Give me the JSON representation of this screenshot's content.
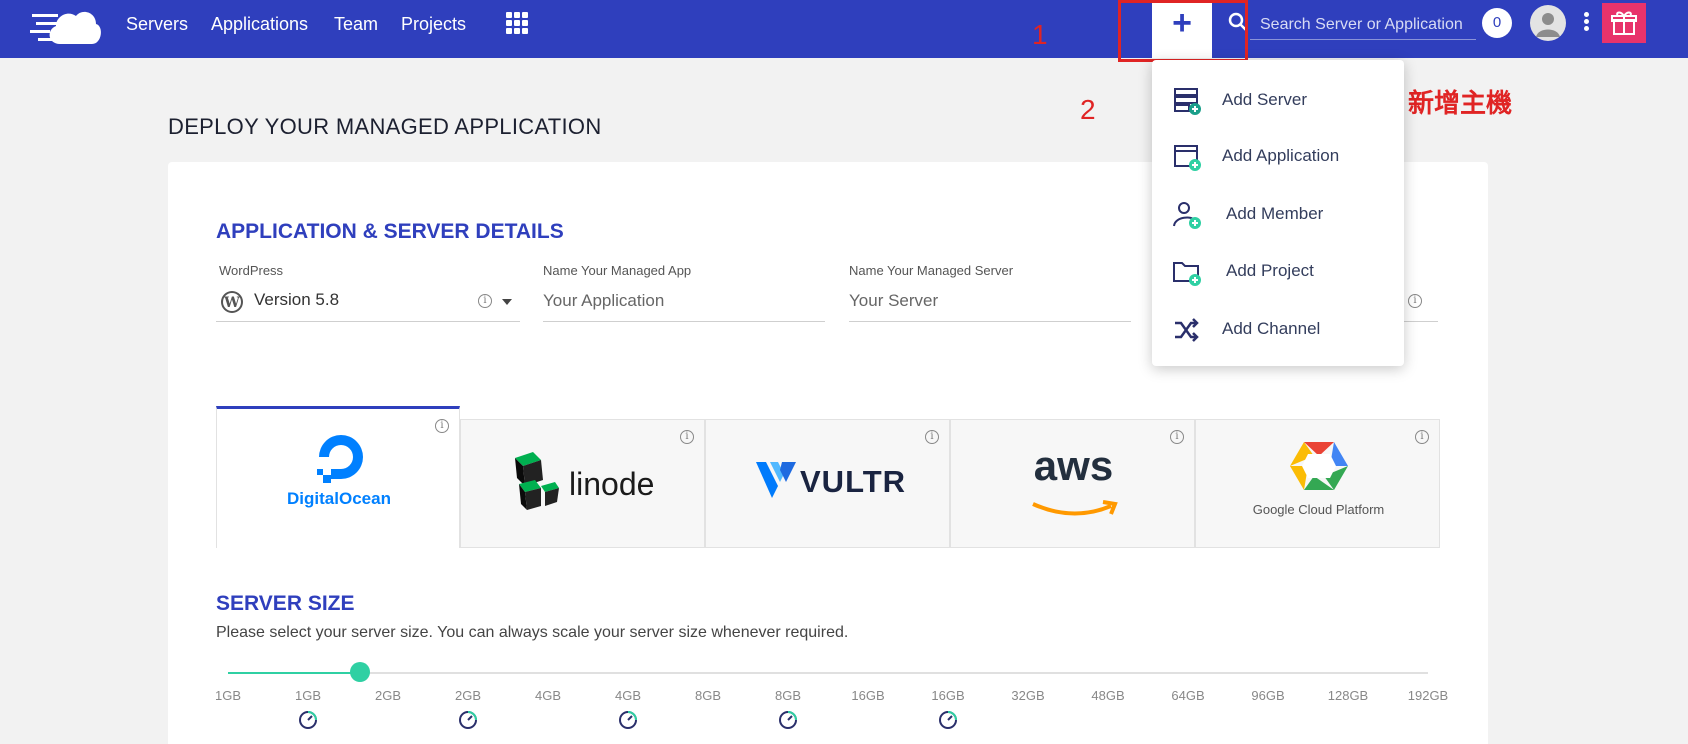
{
  "nav": {
    "items": [
      "Servers",
      "Applications",
      "Team",
      "Projects"
    ],
    "search_placeholder": "Search Server or Application",
    "notifications": "0",
    "plus": "+"
  },
  "annotations": {
    "step1": "1",
    "step2": "2",
    "add_server_cn": "新增主機"
  },
  "menu": {
    "items": [
      "Add Server",
      "Add Application",
      "Add Member",
      "Add Project",
      "Add Channel"
    ]
  },
  "page": {
    "title": "DEPLOY YOUR MANAGED APPLICATION"
  },
  "details": {
    "title": "APPLICATION & SERVER DETAILS",
    "app_label": "WordPress",
    "app_version": "Version 5.8",
    "name_app_label": "Name Your Managed App",
    "name_app_placeholder": "Your Application",
    "name_server_label": "Name Your Managed Server",
    "name_server_placeholder": "Your Server"
  },
  "providers": {
    "digitalocean": "DigitalOcean",
    "linode": "linode",
    "vultr": "VULTR",
    "aws": "aws",
    "gcp": "Google Cloud Platform",
    "active": "DigitalOcean"
  },
  "server_size": {
    "title": "SERVER SIZE",
    "description": "Please select your server size. You can always scale your server size whenever required.",
    "ticks": [
      "1GB",
      "1GB",
      "2GB",
      "2GB",
      "4GB",
      "4GB",
      "8GB",
      "8GB",
      "16GB",
      "16GB",
      "32GB",
      "48GB",
      "64GB",
      "96GB",
      "128GB",
      "192GB"
    ],
    "selected": "2GB",
    "selected_fraction": 0.1
  },
  "colors": {
    "brand": "#2f3fbd",
    "accent": "#2fd0a3",
    "annotation": "#e02424",
    "gift": "#e8336b"
  }
}
